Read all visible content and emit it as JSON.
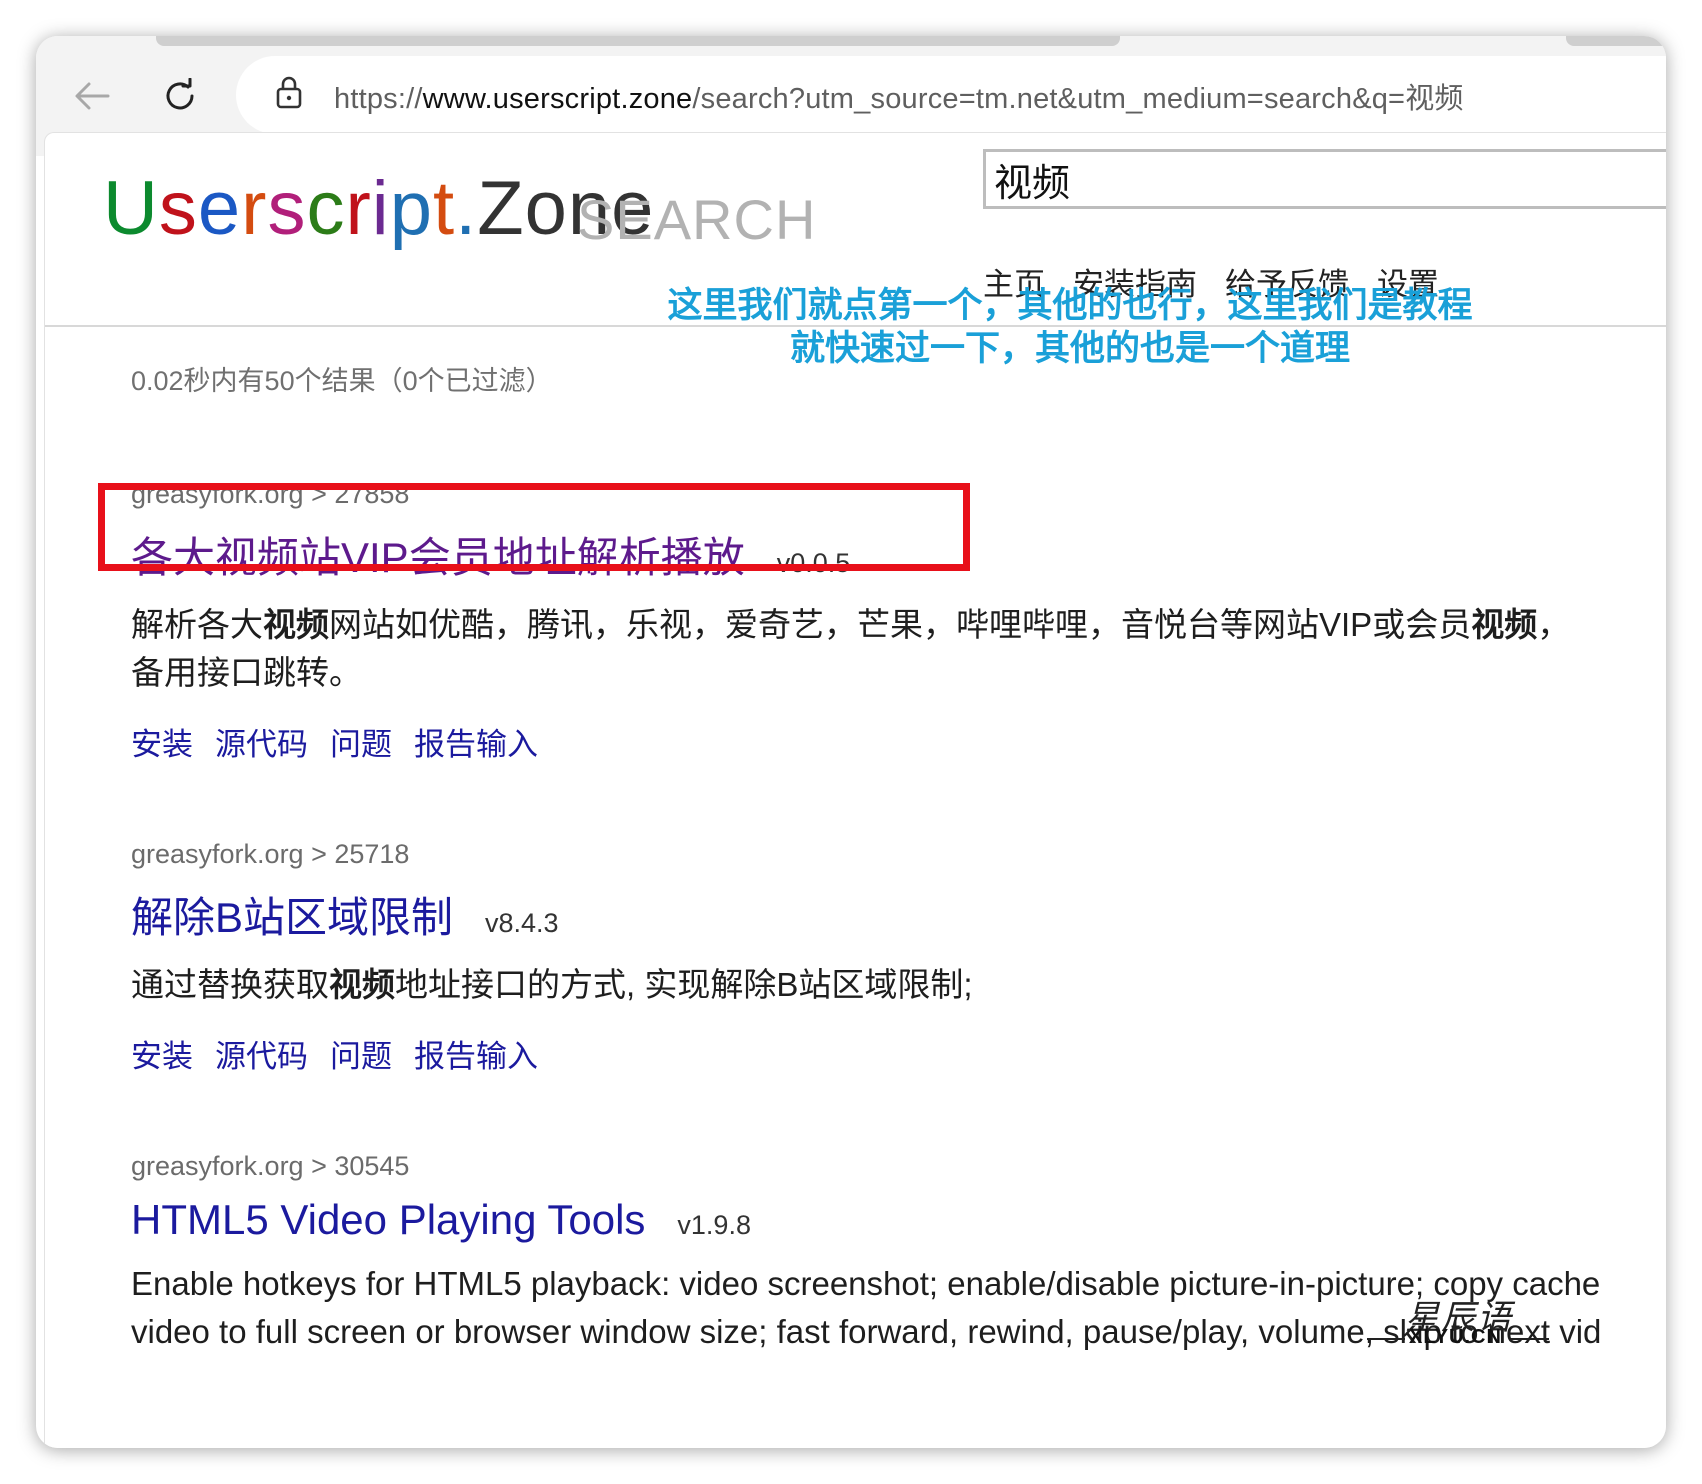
{
  "browser": {
    "url_prefix": "https://",
    "url_host": "www.userscript.zone",
    "url_path": "/search?utm_source=tm.net&utm_medium=search&q=视频"
  },
  "site": {
    "logo_letters": [
      "U",
      "s",
      "e",
      "r",
      "s",
      "c",
      "r",
      "i",
      "p",
      "t",
      ".",
      "Zone"
    ],
    "logo_sub": "SEARCH",
    "search_value": "视频",
    "nav": [
      "主页",
      "安装指南",
      "给予反馈",
      "设置"
    ]
  },
  "stats": "0.02秒内有50个结果（0个已过滤）",
  "annotation": {
    "line1": "这里我们就点第一个，其他的也行，这里我们是教程",
    "line2": "就快速过一下，其他的也是一个道理"
  },
  "results": [
    {
      "source": "greasyfork.org > 27858",
      "title": "各大视频站VIP会员地址解析播放",
      "version": "v0.0.5",
      "desc_parts": [
        {
          "t": "解析各大",
          "b": false
        },
        {
          "t": "视频",
          "b": true
        },
        {
          "t": "网站如优酷，腾讯，乐视，爱奇艺，芒果，哔哩哔哩，音悦台等网站VIP或会员",
          "b": false
        },
        {
          "t": "视频",
          "b": true
        },
        {
          "t": "，\n备用接口跳转。",
          "b": false
        }
      ],
      "links": [
        "安装",
        "源代码",
        "问题",
        "报告输入"
      ]
    },
    {
      "source": "greasyfork.org > 25718",
      "title": "解除B站区域限制",
      "version": "v8.4.3",
      "desc_parts": [
        {
          "t": "通过替换获取",
          "b": false
        },
        {
          "t": "视频",
          "b": true
        },
        {
          "t": "地址接口的方式, 实现解除B站区域限制;",
          "b": false
        }
      ],
      "links": [
        "安装",
        "源代码",
        "问题",
        "报告输入"
      ]
    },
    {
      "source": "greasyfork.org > 30545",
      "title": "HTML5 Video Playing Tools",
      "version": "v1.9.8",
      "desc_parts": [
        {
          "t": "Enable hotkeys for HTML5 playback: video screenshot; enable/disable picture-in-picture; copy cache\nvideo to full screen or browser window size; fast forward, rewind, pause/play, volume, skip to next vid",
          "b": false
        }
      ],
      "links": []
    }
  ],
  "watermark": {
    "script": "星辰语",
    "text": "XLYU.CN"
  }
}
